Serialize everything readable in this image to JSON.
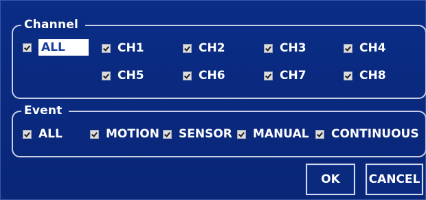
{
  "channel": {
    "legend": "Channel",
    "all_label": "ALL",
    "channels": [
      "CH1",
      "CH2",
      "CH3",
      "CH4",
      "CH5",
      "CH6",
      "CH7",
      "CH8"
    ]
  },
  "event": {
    "legend": "Event",
    "options": [
      "ALL",
      "MOTION",
      "SENSOR",
      "MANUAL",
      "CONTINUOUS"
    ]
  },
  "buttons": {
    "ok": "OK",
    "cancel": "CANCEL"
  },
  "colors": {
    "background": "#0a2a7e",
    "focus_text": "#1a3e9e",
    "border": "#c8d0e8"
  }
}
